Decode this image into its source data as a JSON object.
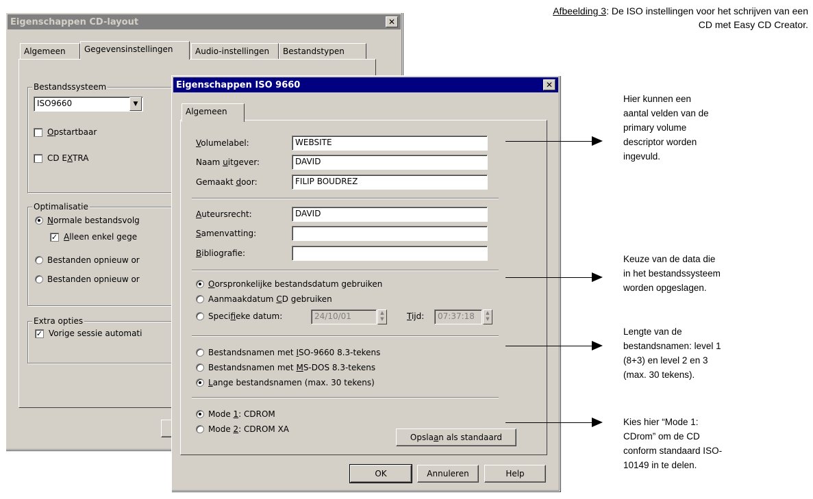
{
  "caption": {
    "ref": "Afbeelding 3",
    "line1": ": De ISO instellingen voor het schrijven van een",
    "line2": "CD met Easy CD Creator."
  },
  "back_dialog": {
    "title": "Eigenschappen CD-layout",
    "close": "✕",
    "tabs": [
      "Algemeen",
      "Gegevensinstellingen",
      "Audio-instellingen",
      "Bestandstypen"
    ],
    "selected_tab": "Gegevensinstellingen",
    "fs_group": "Bestandssysteem",
    "fs_value": "ISO9660",
    "opstartbaar_u": "O",
    "opstartbaar_rest": "pstartbaar",
    "cdextra_a": "CD E",
    "cdextra_u": "X",
    "cdextra_b": "TRA",
    "opt_group": "Optimalisatie",
    "opt1_u": "N",
    "opt1_rest": "ormale bestandsvolg",
    "opt1_sub_u": "A",
    "opt1_sub_rest": "lleen enkel gege",
    "opt2": "Bestanden opnieuw or",
    "opt3": "Bestanden opnieuw or",
    "extra_group": "Extra opties",
    "extra1": "Vorige sessie automati"
  },
  "front_dialog": {
    "title": "Eigenschappen ISO 9660",
    "close": "✕",
    "tab": "Algemeen",
    "fields": [
      {
        "u": "V",
        "rest": "olumelabel:",
        "value": "WEBSITE"
      },
      {
        "pre": "Naam ",
        "u": "u",
        "rest": "itgever:",
        "value": "DAVID"
      },
      {
        "pre": "Gemaakt ",
        "u": "d",
        "rest": "oor:",
        "value": "FILIP BOUDREZ"
      },
      {
        "u": "A",
        "rest": "uteursrecht:",
        "value": "DAVID"
      },
      {
        "u": "S",
        "rest": "amenvatting:",
        "value": ""
      },
      {
        "u": "B",
        "rest": "ibliografie:",
        "value": ""
      }
    ],
    "date_opts": {
      "o1_u": "O",
      "o1_rest": "orspronkelijke bestandsdatum gebruiken",
      "o2_pre": "Aanmaakdatum ",
      "o2_u": "C",
      "o2_rest": "D gebruiken",
      "o3_pre": "Speci",
      "o3_u": "f",
      "o3_rest": "ieke datum:",
      "date_value": "24/10/01",
      "time_u": "T",
      "time_rest": "ijd:",
      "time_value": "07:37:18"
    },
    "name_opts": {
      "n1_pre": "Bestandsnamen met ",
      "n1_u": "I",
      "n1_rest": "SO-9660 8.3-tekens",
      "n2_pre": "Bestandsnamen met ",
      "n2_u": "M",
      "n2_rest": "S-DOS 8.3-tekens",
      "n3_u": "L",
      "n3_rest": "ange bestandsnamen (max. 30 tekens)"
    },
    "mode_opts": {
      "m1_pre": "Mode ",
      "m1_u": "1",
      "m1_rest": ": CDROM",
      "m2_pre": "Mode ",
      "m2_u": "2",
      "m2_rest": ": CDROM XA"
    },
    "save_default": {
      "pre": "Opsla",
      "u": "a",
      "rest": "n als standaard"
    },
    "ok": "OK",
    "cancel": "Annuleren",
    "help": "Help"
  },
  "annotations": [
    {
      "lines": [
        "Hier kunnen een",
        "aantal velden van de",
        "primary volume",
        "descriptor worden",
        "ingevuld."
      ]
    },
    {
      "lines": [
        "Keuze van de data die",
        "in het bestandssysteem",
        "worden opgeslagen."
      ]
    },
    {
      "lines": [
        "Lengte van de",
        "bestandsnamen: level 1",
        "(8+3) en level 2 en 3",
        "(max. 30 tekens)."
      ]
    },
    {
      "lines": [
        "Kies hier “Mode 1:",
        "CDrom” om de CD",
        "conform standaard ISO-",
        "10149 in te delen."
      ]
    }
  ]
}
